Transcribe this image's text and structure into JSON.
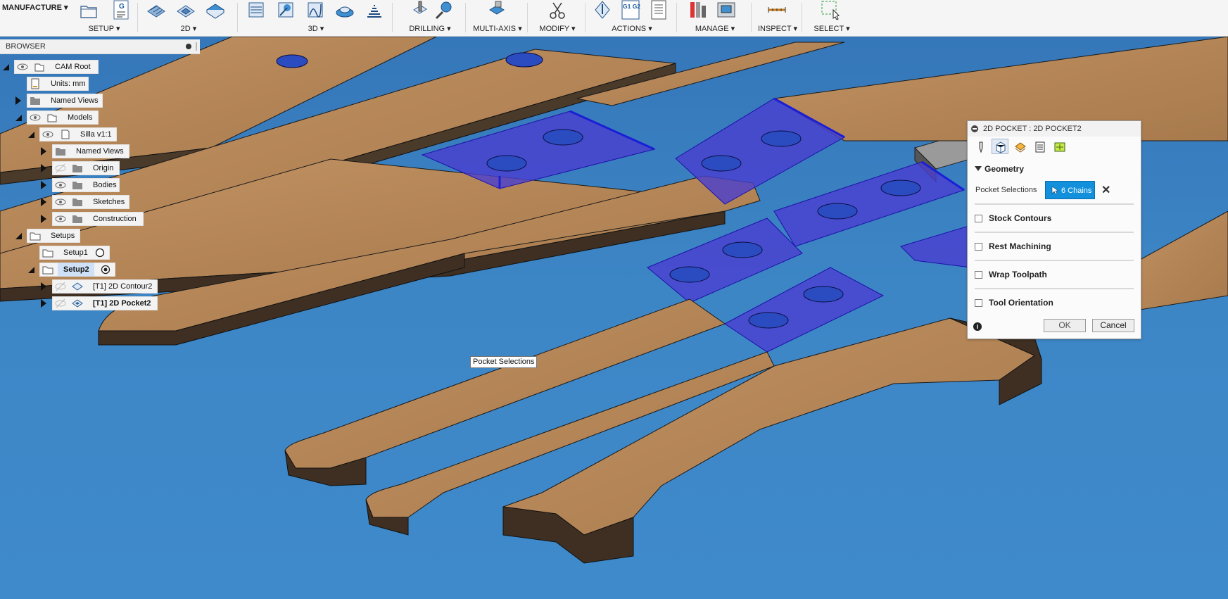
{
  "workspace": {
    "label": "MANUFACTURE"
  },
  "toolbar": {
    "groups": [
      {
        "label": "SETUP",
        "icons": [
          "setup-folder-icon",
          "nc-program-icon"
        ]
      },
      {
        "label": "2D",
        "icons": [
          "2d-adaptive-icon",
          "2d-pocket-icon",
          "face-icon"
        ]
      },
      {
        "label": "3D",
        "icons": [
          "3d-adaptive-icon",
          "3d-pocket-icon",
          "parallel-icon",
          "radial-icon",
          "spiral-icon"
        ]
      },
      {
        "label": "DRILLING",
        "icons": [
          "drill-icon",
          "probe-icon"
        ]
      },
      {
        "label": "MULTI-AXIS",
        "icons": [
          "multi-axis-icon"
        ]
      },
      {
        "label": "MODIFY",
        "icons": [
          "modify-tools-icon"
        ]
      },
      {
        "label": "ACTIONS",
        "icons": [
          "simulate-icon",
          "post-process-icon",
          "setup-sheet-icon"
        ]
      },
      {
        "label": "MANAGE",
        "icons": [
          "tool-library-icon",
          "machine-icon"
        ]
      },
      {
        "label": "INSPECT",
        "icons": [
          "measure-icon"
        ]
      },
      {
        "label": "SELECT",
        "icons": [
          "window-select-icon"
        ]
      }
    ],
    "dropdown_glyph": "▾",
    "icon_glyphs": {
      "nc-program-icon": "G",
      "post-process-icon": "G1 G2"
    }
  },
  "browser": {
    "title": "BROWSER",
    "nodes": [
      {
        "label": "CAM Root",
        "level": 0,
        "expanded": true,
        "eye": true,
        "icon": "cam-root-icon"
      },
      {
        "label": "Units: mm",
        "level": 1,
        "expanded": null,
        "eye": false,
        "icon": "units-document-icon"
      },
      {
        "label": "Named Views",
        "level": 1,
        "expanded": false,
        "eye": false,
        "icon": "folder-icon"
      },
      {
        "label": "Models",
        "level": 1,
        "expanded": true,
        "eye": true,
        "icon": "models-icon"
      },
      {
        "label": "Silla v1:1",
        "level": 2,
        "expanded": true,
        "eye": true,
        "icon": "component-icon"
      },
      {
        "label": "Named Views",
        "level": 3,
        "expanded": false,
        "eye": false,
        "icon": "folder-icon"
      },
      {
        "label": "Origin",
        "level": 3,
        "expanded": false,
        "eye": "hidden",
        "icon": "folder-icon"
      },
      {
        "label": "Bodies",
        "level": 3,
        "expanded": false,
        "eye": true,
        "icon": "folder-icon"
      },
      {
        "label": "Sketches",
        "level": 3,
        "expanded": false,
        "eye": true,
        "icon": "folder-icon"
      },
      {
        "label": "Construction",
        "level": 3,
        "expanded": false,
        "eye": true,
        "icon": "folder-icon"
      },
      {
        "label": "Setups",
        "level": 1,
        "expanded": true,
        "eye": false,
        "icon": "setups-folder-icon"
      },
      {
        "label": "Setup1",
        "level": 2,
        "expanded": null,
        "eye": false,
        "icon": "setup-icon",
        "marker": "radio-empty"
      },
      {
        "label": "Setup2",
        "level": 2,
        "expanded": true,
        "eye": false,
        "icon": "setup-icon",
        "marker": "radio-active",
        "selected": true
      },
      {
        "label": "[T1] 2D Contour2",
        "level": 3,
        "expanded": false,
        "eye": "hidden",
        "icon": "2d-contour-op-icon"
      },
      {
        "label": "[T1] 2D Pocket2",
        "level": 3,
        "expanded": false,
        "eye": "hidden",
        "icon": "2d-pocket-op-icon",
        "bold": true
      }
    ]
  },
  "viewport": {
    "tooltip": "Pocket Selections"
  },
  "dialog": {
    "title": "2D POCKET : 2D POCKET2",
    "tabs": [
      "tool-tab-icon",
      "geometry-tab-icon",
      "heights-tab-icon",
      "passes-tab-icon",
      "linking-tab-icon"
    ],
    "active_tab": 1,
    "geometry": {
      "label": "Geometry",
      "pocket_selections_label": "Pocket Selections",
      "chains_label": "6 Chains",
      "clear_glyph": "✕"
    },
    "sections": [
      "Stock Contours",
      "Rest Machining",
      "Wrap Toolpath",
      "Tool Orientation"
    ],
    "ok_label": "OK",
    "cancel_label": "Cancel",
    "info_glyph": "i"
  },
  "colors": {
    "viewport_bg": "#3d86c6",
    "wood": "#b8895a",
    "selection": "#4a3fd0",
    "accent": "#1290db"
  }
}
